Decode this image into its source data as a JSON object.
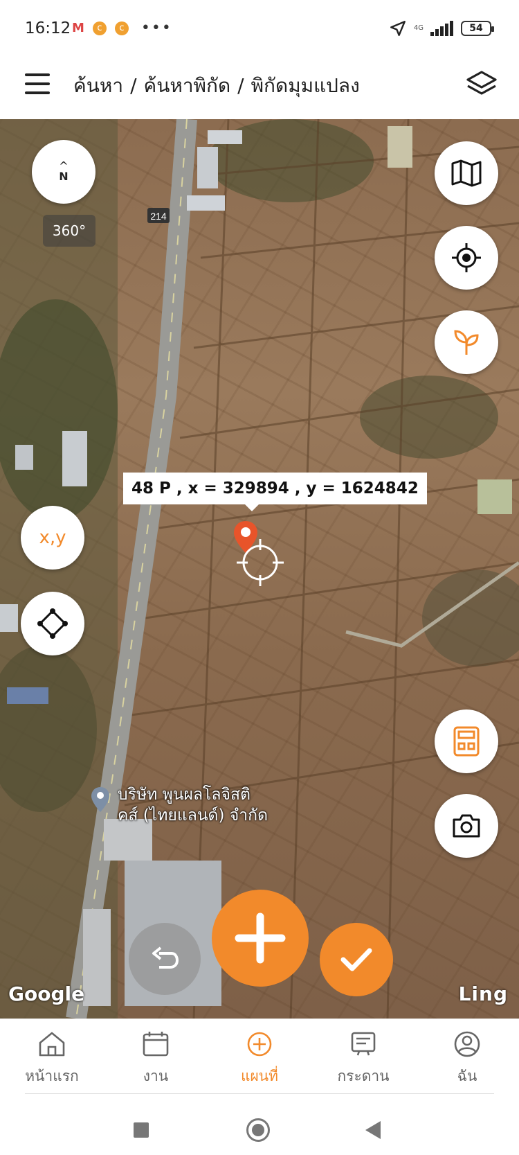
{
  "status_bar": {
    "time": "16:12",
    "mail_icon": "M",
    "coin_icon": "c",
    "more": "•••",
    "network": "4G",
    "battery": "54"
  },
  "header": {
    "breadcrumb": [
      "ค้นหา",
      "ค้นหาพิกัด",
      "พิกัดมุมแปลง"
    ],
    "separator": "/"
  },
  "map": {
    "compass_north": "N",
    "compass_arrow": "^",
    "rotation_label": "360°",
    "road_number": "214",
    "coordinate_label": "48 P , x = 329894 , y = 1624842",
    "xy_button_label": "x,y",
    "place_name_line1": "บริษัท พูนผลโลจิสติ",
    "place_name_line2": "คส์ (ไทยแลนด์) จำกัด",
    "google_attribution": "Google",
    "provider_attribution": "Ling"
  },
  "bottom_nav": [
    {
      "label": "หน้าแรก",
      "icon": "home-icon",
      "active": false
    },
    {
      "label": "งาน",
      "icon": "calendar-icon",
      "active": false
    },
    {
      "label": "แผนที่",
      "icon": "plus-circle-icon",
      "active": true
    },
    {
      "label": "กระดาน",
      "icon": "board-icon",
      "active": false
    },
    {
      "label": "ฉัน",
      "icon": "user-icon",
      "active": false
    }
  ],
  "colors": {
    "accent": "#f28a2b",
    "pin": "#e8542a"
  }
}
